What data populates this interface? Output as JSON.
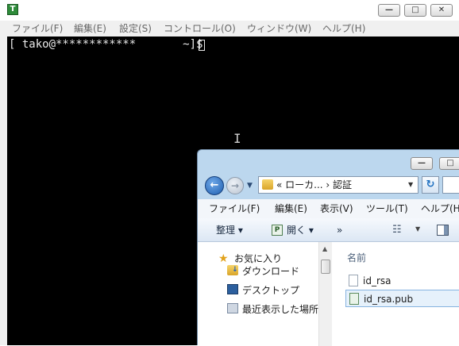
{
  "terminal": {
    "menu": [
      "ファイル(F)",
      "編集(E)",
      "設定(S)",
      "コントロール(O)",
      "ウィンドウ(W)",
      "ヘルプ(H)"
    ],
    "prompt": "[ tako@************       ~]$",
    "caption_buttons": {
      "minimize": "—",
      "maximize": "□",
      "close": "✕"
    }
  },
  "explorer": {
    "address": "«  ローカ...  ›  認証",
    "menu": [
      "ファイル(F)",
      "編集(E)",
      "表示(V)",
      "ツール(T)",
      "ヘルプ(H"
    ],
    "toolbar": {
      "organize": "整理",
      "open": "開く",
      "more": "»"
    },
    "nav_pane": [
      "お気に入り",
      "ダウンロード",
      "デスクトップ",
      "最近表示した場所"
    ],
    "column_header": "名前",
    "files": [
      "id_rsa",
      "id_rsa.pub"
    ],
    "selected_file": "id_rsa.pub",
    "caption_buttons": {
      "minimize": "—",
      "maximize": "□"
    }
  },
  "icons": [
    "terminal-app-icon",
    "back-arrow-icon",
    "forward-arrow-icon",
    "folder-icon",
    "refresh-icon",
    "open-icon",
    "views-icon",
    "preview-pane-icon",
    "star-icon",
    "downloads-folder-icon",
    "desktop-icon",
    "recent-places-icon",
    "file-icon",
    "pub-key-file-icon",
    "text-cursor-icon"
  ],
  "colors": {
    "terminal_bg": "#000000",
    "terminal_fg": "#e8e8e8",
    "explorer_chrome": "#bcd7ee",
    "selection": "#e6f1fb"
  }
}
